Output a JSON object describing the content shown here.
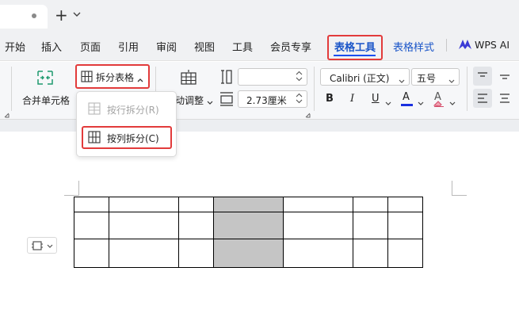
{
  "titlebar": {
    "new_tab_symbol": "+",
    "tab_menu_symbol": "⌄"
  },
  "menu": {
    "items": [
      "开始",
      "插入",
      "页面",
      "引用",
      "审阅",
      "视图",
      "工具",
      "会员专享"
    ],
    "active_tab": "表格工具",
    "table_style_tab": "表格样式",
    "wps_ai": "WPS AI"
  },
  "ribbon": {
    "merge_cells": "合并单元格",
    "split_table": "拆分表格",
    "auto_fit": "动调整",
    "width_value": "",
    "height_value": "2.73厘米",
    "font_name": "Calibri (正文)",
    "font_size": "五号",
    "bold": "B",
    "italic": "I",
    "underline": "U",
    "font_color": "A",
    "clear_format": "A"
  },
  "split_menu": {
    "split_rows": "按行拆分(R)",
    "split_cols": "按列拆分(C)"
  },
  "colors": {
    "highlight_red": "#e23b3b",
    "accent_blue": "#1a4ef0",
    "tab_blue": "#1a55c8",
    "shaded_cell": "#c5c5c5"
  }
}
